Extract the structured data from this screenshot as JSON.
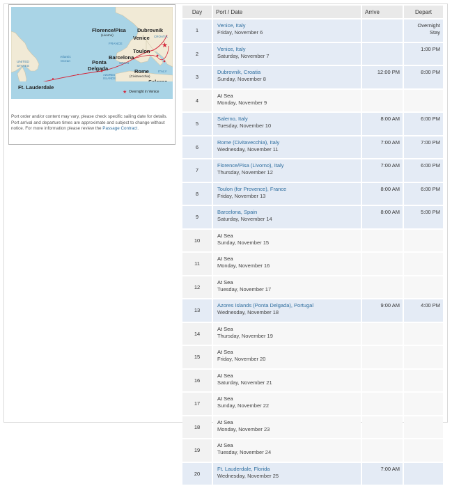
{
  "map": {
    "labels": {
      "florence": "Florence/Pisa",
      "livorno": "(Livorno)",
      "dubrovnik": "Dubrovnik",
      "venice": "Venice",
      "croatia": "CROATIA",
      "france": "FRANCE",
      "toulon": "Toulon",
      "barcelona": "Barcelona",
      "spain": "SPAIN",
      "united_states": "UNITED STATES",
      "atlantic": "Atlantic Ocean",
      "ponta": "Ponta",
      "delgada": "Delgada",
      "azores": "AZORES ISLANDS",
      "rome": "Rome",
      "civitavecchia": "(Civitavecchia)",
      "italy": "ITALY",
      "salerno": "Salerno",
      "ft_lauderdale": "Ft. Lauderdale",
      "overnight": "Overnight in Venice"
    }
  },
  "note": {
    "text": "Port order and/or content may vary, please check specific sailing date for details. Port arrival and departure times are approximate and subject to change without notice. For more information please review the ",
    "link": "Passage Contract",
    "end": "."
  },
  "table": {
    "headers": {
      "day": "Day",
      "port": "Port / Date",
      "arrive": "Arrive",
      "depart": "Depart"
    },
    "rows": [
      {
        "day": "1",
        "port": "Venice, Italy",
        "date": "Friday, November 6",
        "arrive": "",
        "depart": "Overnight\nStay",
        "link": true
      },
      {
        "day": "2",
        "port": "Venice, Italy",
        "date": "Saturday, November 7",
        "arrive": "",
        "depart": "1:00 PM",
        "link": true
      },
      {
        "day": "3",
        "port": "Dubrovnik, Croatia",
        "date": "Sunday, November 8",
        "arrive": "12:00 PM",
        "depart": "8:00 PM",
        "link": true
      },
      {
        "day": "4",
        "port": "At Sea",
        "date": "Monday, November 9",
        "arrive": "",
        "depart": "",
        "link": false
      },
      {
        "day": "5",
        "port": "Salerno, Italy",
        "date": "Tuesday, November 10",
        "arrive": "8:00 AM",
        "depart": "6:00 PM",
        "link": true
      },
      {
        "day": "6",
        "port": "Rome (Civitavecchia), Italy",
        "date": "Wednesday, November 11",
        "arrive": "7:00 AM",
        "depart": "7:00 PM",
        "link": true
      },
      {
        "day": "7",
        "port": "Florence/Pisa (Livorno), Italy",
        "date": "Thursday, November 12",
        "arrive": "7:00 AM",
        "depart": "6:00 PM",
        "link": true
      },
      {
        "day": "8",
        "port": "Toulon (for Provence), France",
        "date": "Friday, November 13",
        "arrive": "8:00 AM",
        "depart": "6:00 PM",
        "link": true
      },
      {
        "day": "9",
        "port": "Barcelona, Spain",
        "date": "Saturday, November 14",
        "arrive": "8:00 AM",
        "depart": "5:00 PM",
        "link": true
      },
      {
        "day": "10",
        "port": "At Sea",
        "date": "Sunday, November 15",
        "arrive": "",
        "depart": "",
        "link": false
      },
      {
        "day": "11",
        "port": "At Sea",
        "date": "Monday, November 16",
        "arrive": "",
        "depart": "",
        "link": false
      },
      {
        "day": "12",
        "port": "At Sea",
        "date": "Tuesday, November 17",
        "arrive": "",
        "depart": "",
        "link": false
      },
      {
        "day": "13",
        "port": "Azores Islands (Ponta Delgada), Portugal",
        "date": "Wednesday, November 18",
        "arrive": "9:00 AM",
        "depart": "4:00 PM",
        "link": true
      },
      {
        "day": "14",
        "port": "At Sea",
        "date": "Thursday, November 19",
        "arrive": "",
        "depart": "",
        "link": false
      },
      {
        "day": "15",
        "port": "At Sea",
        "date": "Friday, November 20",
        "arrive": "",
        "depart": "",
        "link": false
      },
      {
        "day": "16",
        "port": "At Sea",
        "date": "Saturday, November 21",
        "arrive": "",
        "depart": "",
        "link": false
      },
      {
        "day": "17",
        "port": "At Sea",
        "date": "Sunday, November 22",
        "arrive": "",
        "depart": "",
        "link": false
      },
      {
        "day": "18",
        "port": "At Sea",
        "date": "Monday, November 23",
        "arrive": "",
        "depart": "",
        "link": false
      },
      {
        "day": "19",
        "port": "At Sea",
        "date": "Tuesday, November 24",
        "arrive": "",
        "depart": "",
        "link": false
      },
      {
        "day": "20",
        "port": "Ft. Lauderdale, Florida",
        "date": "Wednesday, November 25",
        "arrive": "7:00 AM",
        "depart": "",
        "link": true
      }
    ]
  }
}
